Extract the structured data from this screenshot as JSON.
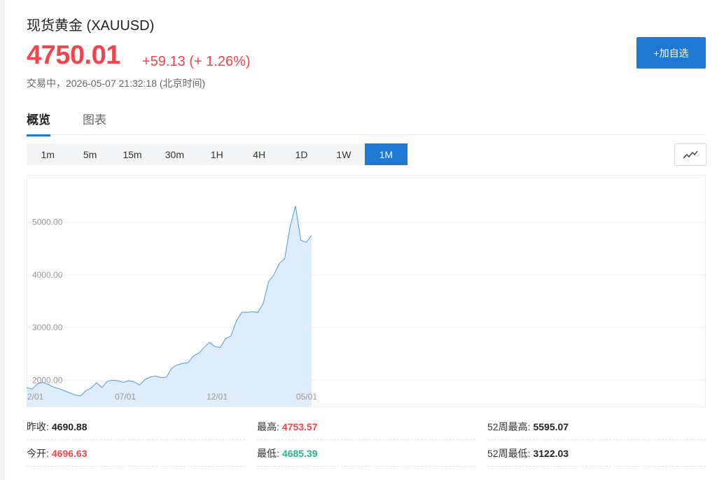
{
  "header": {
    "title": "现货黄金 (XAUUSD)",
    "price": "4750.01",
    "change": "+59.13 (+ 1.26%)",
    "status": "交易中，2026-05-07 21:32:18 (北京时间)",
    "add_button": "+加自选"
  },
  "tabs": [
    {
      "label": "概览",
      "active": true
    },
    {
      "label": "图表",
      "active": false
    }
  ],
  "periods": [
    {
      "label": "1m",
      "active": false
    },
    {
      "label": "5m",
      "active": false
    },
    {
      "label": "15m",
      "active": false
    },
    {
      "label": "30m",
      "active": false
    },
    {
      "label": "1H",
      "active": false
    },
    {
      "label": "4H",
      "active": false
    },
    {
      "label": "1D",
      "active": false
    },
    {
      "label": "1W",
      "active": false
    },
    {
      "label": "1M",
      "active": true
    }
  ],
  "chart_type_icon": "line-chart-icon",
  "colors": {
    "up": "#f0454a",
    "down": "#28b28b",
    "accent": "#1f78d1",
    "line": "#4a9be0",
    "fill": "#deedfb"
  },
  "chart_data": {
    "type": "area",
    "title": "",
    "xlabel": "",
    "ylabel": "",
    "ylim": [
      1500,
      5900
    ],
    "yticks": [
      "2000.00",
      "3000.00",
      "4000.00",
      "5000.00"
    ],
    "xticks": [
      "2/01",
      "07/01",
      "12/01",
      "05/01"
    ],
    "grid": true,
    "series": [
      {
        "values": [
          1860,
          1830,
          1930,
          1960,
          1920,
          1870,
          1840,
          1800,
          1760,
          1720,
          1700,
          1800,
          1850,
          1950,
          1860,
          1980,
          2000,
          1990,
          1960,
          1990,
          1970,
          1910,
          2010,
          2060,
          2080,
          2050,
          2060,
          2230,
          2290,
          2320,
          2330,
          2460,
          2510,
          2620,
          2720,
          2640,
          2620,
          2790,
          2840,
          3120,
          3290,
          3290,
          3300,
          3290,
          3460,
          3870,
          4000,
          4220,
          4310,
          4920,
          5310,
          4660,
          4620,
          4750.01
        ]
      }
    ]
  },
  "stats": {
    "prev_close_label": "昨收:",
    "prev_close": "4690.88",
    "open_label": "今开:",
    "open": "4696.63",
    "high_label": "最高:",
    "high": "4753.57",
    "low_label": "最低:",
    "low": "4685.39",
    "wk52_high_label": "52周最高:",
    "wk52_high": "5595.07",
    "wk52_low_label": "52周最低:",
    "wk52_low": "3122.03"
  }
}
